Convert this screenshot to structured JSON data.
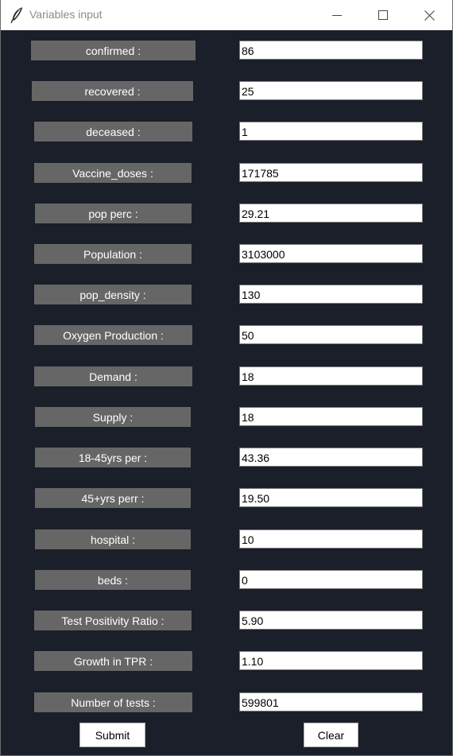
{
  "window": {
    "title": "Variables input",
    "icon": "feather-icon",
    "controls": [
      "minimize-icon",
      "maximize-icon",
      "close-icon"
    ]
  },
  "colors": {
    "background": "#1a1f29",
    "label_background": "#666666",
    "label_text": "#ffffff",
    "field_background": "#ffffff"
  },
  "fields": [
    {
      "label": "confirmed :",
      "value": "86"
    },
    {
      "label": "recovered :",
      "value": "25"
    },
    {
      "label": "deceased :",
      "value": "1"
    },
    {
      "label": "Vaccine_doses :",
      "value": "171785"
    },
    {
      "label": "pop perc :",
      "value": "29.21"
    },
    {
      "label": "Population :",
      "value": "3103000"
    },
    {
      "label": "pop_density :",
      "value": "130"
    },
    {
      "label": "Oxygen Production :",
      "value": "50"
    },
    {
      "label": "Demand :",
      "value": "18"
    },
    {
      "label": "Supply :",
      "value": "18"
    },
    {
      "label": "18-45yrs per :",
      "value": "43.36"
    },
    {
      "label": "45+yrs perr :",
      "value": "19.50"
    },
    {
      "label": "hospital :",
      "value": "10"
    },
    {
      "label": "beds :",
      "value": "0"
    },
    {
      "label": "Test Positivity Ratio :",
      "value": "5.90"
    },
    {
      "label": "Growth in TPR :",
      "value": "1.10"
    },
    {
      "label": "Number of tests :",
      "value": "599801"
    }
  ],
  "buttons": {
    "submit": "Submit",
    "clear": "Clear"
  }
}
